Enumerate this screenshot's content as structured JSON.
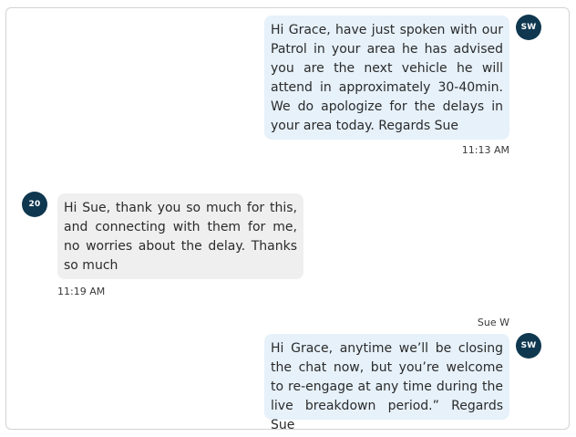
{
  "messages": [
    {
      "sender": "agent",
      "avatar": "SW",
      "text": "Hi Grace, have just spoken with our Patrol in your area he has advised you are the next vehicle he will attend in approximately 30-40min. We do apologize for the delays in your area today. Regards Sue",
      "time": "11:13 AM"
    },
    {
      "sender": "customer",
      "avatar": "20",
      "text": "Hi Sue, thank you so much for this, and connecting with them for me, no worries about the delay. Thanks so much",
      "time": "11:19 AM"
    },
    {
      "sender": "agent",
      "avatar": "SW",
      "name": "Sue W",
      "text": "Hi Grace, anytime we’ll be closing the chat now, but you’re welcome to re-engage at any time during the live breakdown period.” Regards Sue"
    }
  ],
  "colors": {
    "agent_bubble": "#e6f1fa",
    "customer_bubble": "#efefef",
    "avatar": "#0f3850"
  }
}
